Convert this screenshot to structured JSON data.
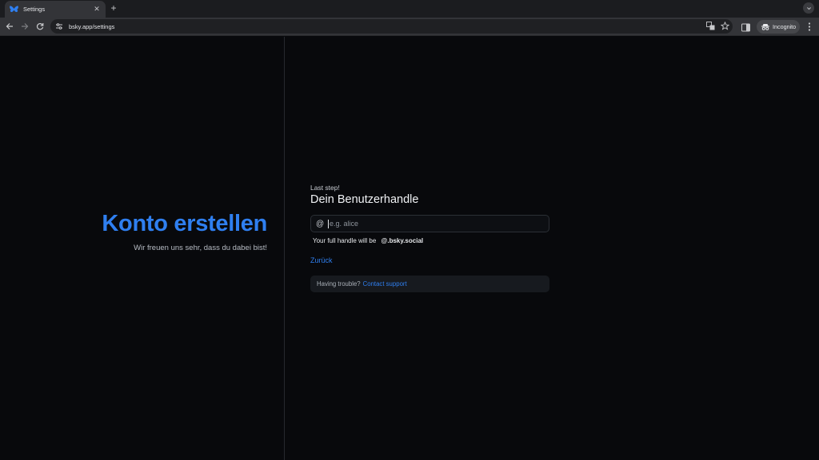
{
  "browser": {
    "tab_title": "Settings",
    "tab_close": "✕",
    "new_tab": "+",
    "url": "bsky.app/settings",
    "incognito_label": "Incognito",
    "icons": [
      "butterfly-icon",
      "back-icon",
      "forward-icon",
      "reload-icon",
      "site-info-icon",
      "translate-icon",
      "star-icon",
      "side-panel-icon",
      "incognito-icon",
      "menu-icon"
    ]
  },
  "left": {
    "title": "Konto erstellen",
    "subtitle": "Wir freuen uns sehr, dass du dabei bist!"
  },
  "form": {
    "step_label": "Last step!",
    "title": "Dein Benutzerhandle",
    "at_symbol": "@",
    "handle_placeholder": "e.g. alice",
    "handle_value": "",
    "full_handle_prefix": "Your full handle will be",
    "full_handle_domain": "@.bsky.social",
    "back_label": "Zurück",
    "trouble_text": "Having trouble?",
    "support_link": "Contact support"
  },
  "colors": {
    "accent": "#2f7ff0",
    "background": "#08090c"
  }
}
